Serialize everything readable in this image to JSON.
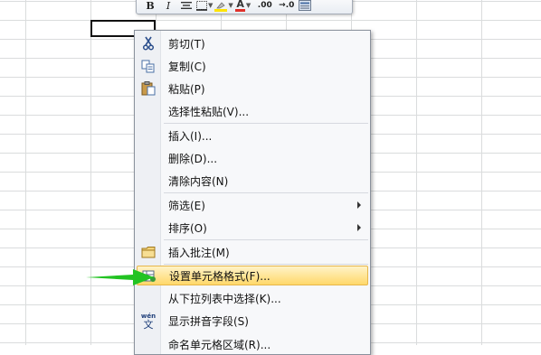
{
  "toolbar": {
    "bold": "B",
    "italic": "I",
    "font_color_letter": "A",
    "increase_decimal": ".00",
    "decrease_decimal": "→.0",
    "icons": [
      "bold-icon",
      "italic-icon",
      "align-icon",
      "border-icon",
      "fill-color-icon",
      "font-color-icon",
      "increase-decimal-icon",
      "decrease-decimal-icon",
      "format-painter-icon"
    ]
  },
  "menu": {
    "cut": "剪切(T)",
    "copy": "复制(C)",
    "paste": "粘贴(P)",
    "paste_special": "选择性粘贴(V)...",
    "insert": "插入(I)...",
    "delete": "删除(D)...",
    "clear_contents": "清除内容(N)",
    "filter": "筛选(E)",
    "sort": "排序(O)",
    "insert_comment": "插入批注(M)",
    "format_cells": "设置单元格格式(F)...",
    "pick_from_list": "从下拉列表中选择(K)...",
    "show_phonetic": "显示拼音字段(S)",
    "define_name": "命名单元格区域(R)...",
    "phonetic_icon_text": "wén",
    "phonetic_icon_char": "文"
  },
  "colors": {
    "highlight_top": "#fff3c8",
    "highlight_bottom": "#ffd86a",
    "arrow_green": "#22c322",
    "font_color_red": "#e0302a"
  }
}
